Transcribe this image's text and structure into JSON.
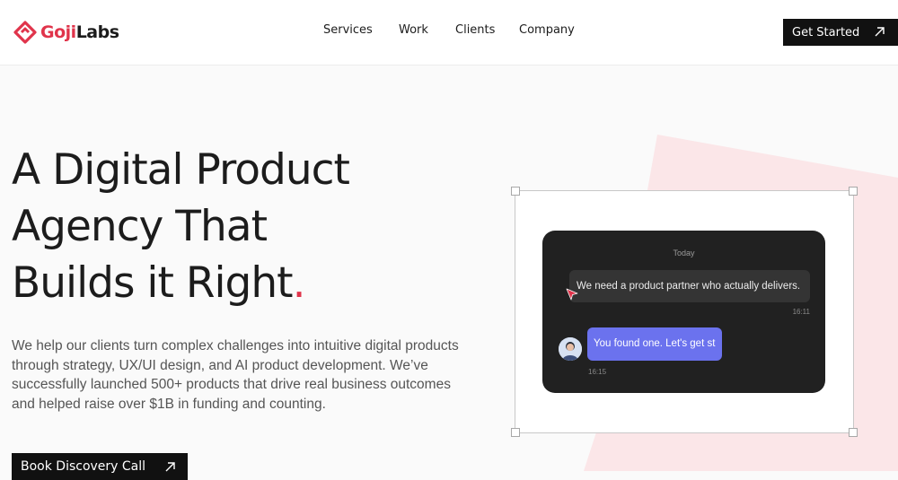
{
  "brand": {
    "name_part1": "Goji",
    "name_part2": "Labs",
    "accent": "#e0344b"
  },
  "nav": {
    "items": [
      "Services",
      "Work",
      "Clients",
      "Company"
    ]
  },
  "header_cta": {
    "label": "Get Started",
    "icon": "arrow-up-right-icon"
  },
  "hero": {
    "headline_lines": [
      "A Digital Product",
      "Agency That",
      "Builds it Right"
    ],
    "headline_dot": ".",
    "description": "We help our clients turn complex challenges into intuitive digital products through strategy, UX/UI design, and AI product development. We’ve successfully launched 500+ products that drive real business outcomes and helped raise over $1B in funding and counting.",
    "cta_label": "Book Discovery Call",
    "cta_icon": "arrow-up-right-icon"
  },
  "chat": {
    "day_label": "Today",
    "message1": {
      "text": "We need a product partner who actually delivers.",
      "time": "16:11"
    },
    "message2": {
      "text": "You found one. Let's get st",
      "time": "16:15"
    },
    "bubble2_color": "#6b72ee"
  }
}
